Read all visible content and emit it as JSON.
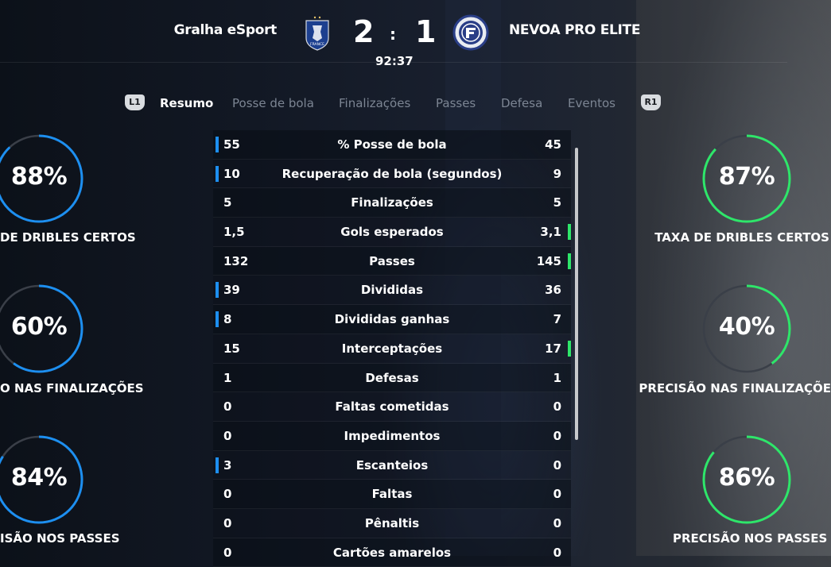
{
  "match": {
    "home_team": "Gralha eSport",
    "away_team": "NEVOA PRO ELITE",
    "home_score": "2",
    "away_score": "1",
    "separator": ":",
    "clock": "92:37",
    "home_crest_text": "FRANCE"
  },
  "tabs": {
    "prev_button": "L1",
    "next_button": "R1",
    "items": [
      "Resumo",
      "Posse de bola",
      "Finalizações",
      "Passes",
      "Defesa",
      "Eventos"
    ],
    "active": "Resumo"
  },
  "home_circles": [
    {
      "value": "88%",
      "label": "DE DRIBLES CERTOS",
      "percent": 88
    },
    {
      "value": "60%",
      "label": "O NAS FINALIZAÇÕES",
      "percent": 60
    },
    {
      "value": "84%",
      "label": "ISÃO NOS PASSES",
      "percent": 84
    }
  ],
  "away_circles": [
    {
      "value": "87%",
      "label": "TAXA DE DRIBLES CERTOS",
      "percent": 87
    },
    {
      "value": "40%",
      "label": "PRECISÃO NAS FINALIZAÇÕE",
      "percent": 40
    },
    {
      "value": "86%",
      "label": "PRECISÃO NOS PASSES",
      "percent": 86
    }
  ],
  "colors": {
    "home_accent": "#1d8ff0",
    "away_accent": "#2ee66a",
    "ring_track": "#3a3f48"
  },
  "stats": [
    {
      "label": "% Posse de bola",
      "home": "55",
      "away": "45",
      "lead": "home"
    },
    {
      "label": "Recuperação de bola (segundos)",
      "home": "10",
      "away": "9",
      "lead": "home"
    },
    {
      "label": "Finalizações",
      "home": "5",
      "away": "5",
      "lead": "none"
    },
    {
      "label": "Gols esperados",
      "home": "1,5",
      "away": "3,1",
      "lead": "away"
    },
    {
      "label": "Passes",
      "home": "132",
      "away": "145",
      "lead": "away"
    },
    {
      "label": "Divididas",
      "home": "39",
      "away": "36",
      "lead": "home"
    },
    {
      "label": "Divididas ganhas",
      "home": "8",
      "away": "7",
      "lead": "home"
    },
    {
      "label": "Interceptações",
      "home": "15",
      "away": "17",
      "lead": "away"
    },
    {
      "label": "Defesas",
      "home": "1",
      "away": "1",
      "lead": "none"
    },
    {
      "label": "Faltas cometidas",
      "home": "0",
      "away": "0",
      "lead": "none"
    },
    {
      "label": "Impedimentos",
      "home": "0",
      "away": "0",
      "lead": "none"
    },
    {
      "label": "Escanteios",
      "home": "3",
      "away": "0",
      "lead": "home"
    },
    {
      "label": "Faltas",
      "home": "0",
      "away": "0",
      "lead": "none"
    },
    {
      "label": "Pênaltis",
      "home": "0",
      "away": "0",
      "lead": "none"
    },
    {
      "label": "Cartões amarelos",
      "home": "0",
      "away": "0",
      "lead": "none"
    }
  ]
}
